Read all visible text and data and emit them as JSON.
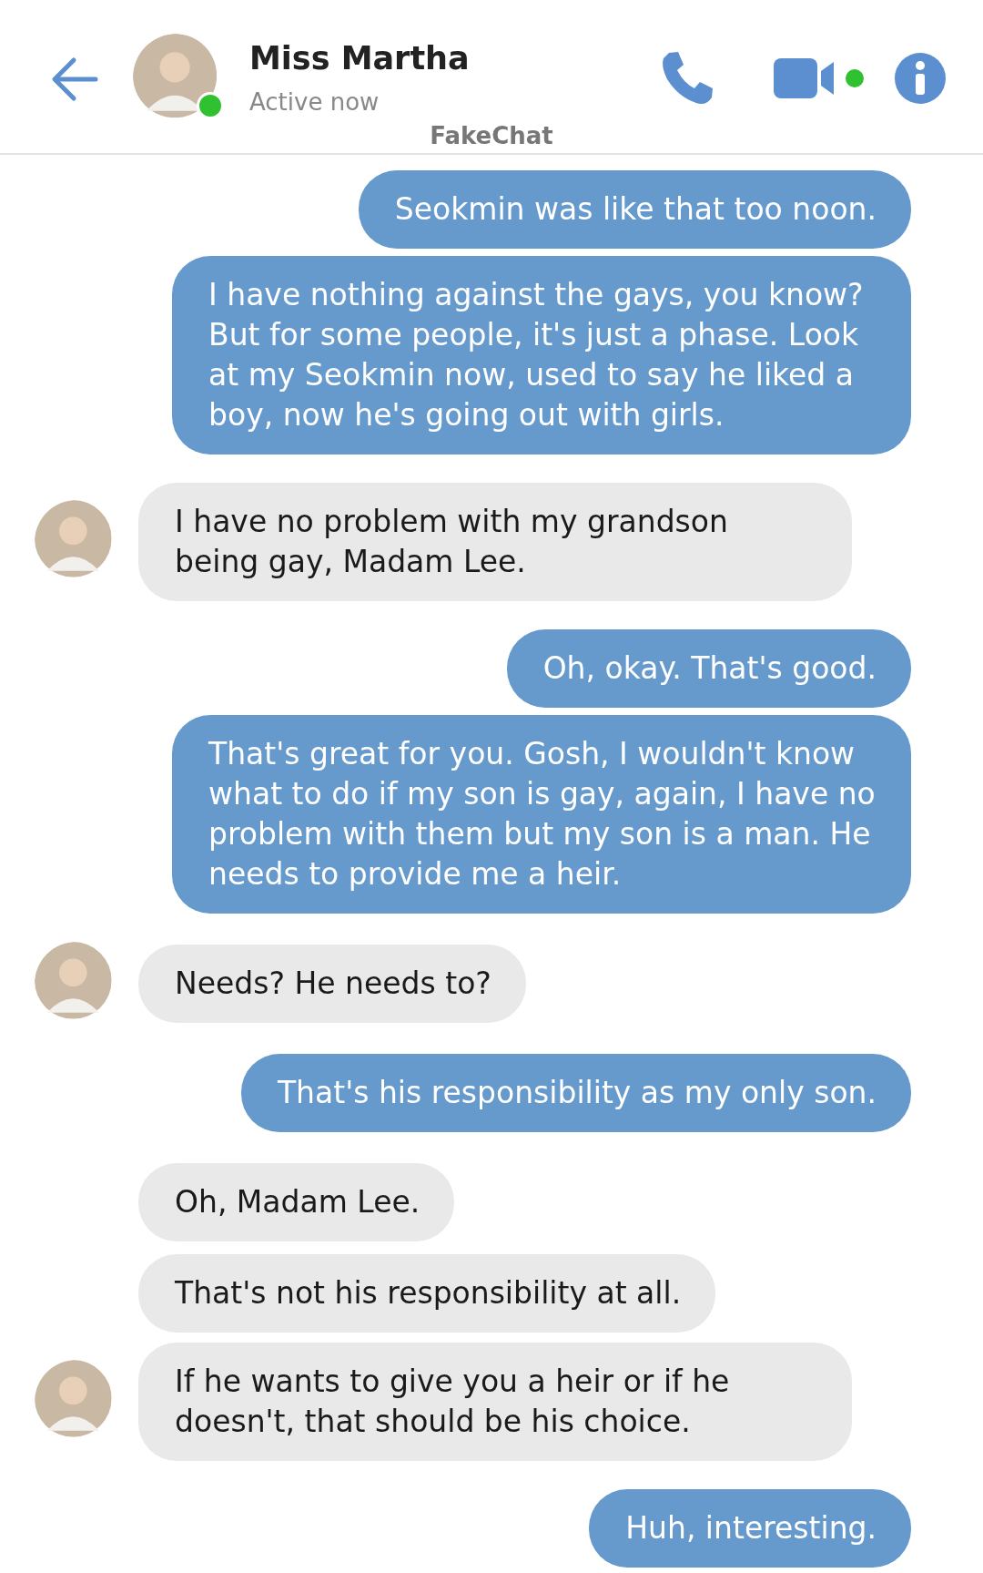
{
  "header": {
    "title": "Miss Martha",
    "status": "Active now",
    "online": true,
    "app_name": "FakeChat"
  },
  "messages": [
    {
      "kind": "sent",
      "text": "Seokmin was like that too noon."
    },
    {
      "kind": "sent",
      "text": "I have nothing against the gays, you know? But for some people, it's just a phase. Look at my Seokmin now, used to say he liked a boy, now he's going out with girls."
    },
    {
      "kind": "received",
      "text": "I have no problem with my grandson being gay, Madam Lee."
    },
    {
      "kind": "sent",
      "text": "Oh, okay. That's good."
    },
    {
      "kind": "sent",
      "text": "That's great for you. Gosh, I wouldn't know what to do if my son is gay, again, I have no problem with them but my son is a man. He needs to provide me a heir."
    },
    {
      "kind": "received",
      "text": "Needs? He needs to?"
    },
    {
      "kind": "sent",
      "text": "That's his responsibility as my only son."
    },
    {
      "kind": "received",
      "text": "Oh, Madam Lee."
    },
    {
      "kind": "received",
      "text": "That's not his responsibility at all."
    },
    {
      "kind": "received",
      "text": "If he wants to give you a heir or if he doesn't, that should be his choice."
    },
    {
      "kind": "sent",
      "text": "Huh, interesting."
    }
  ]
}
